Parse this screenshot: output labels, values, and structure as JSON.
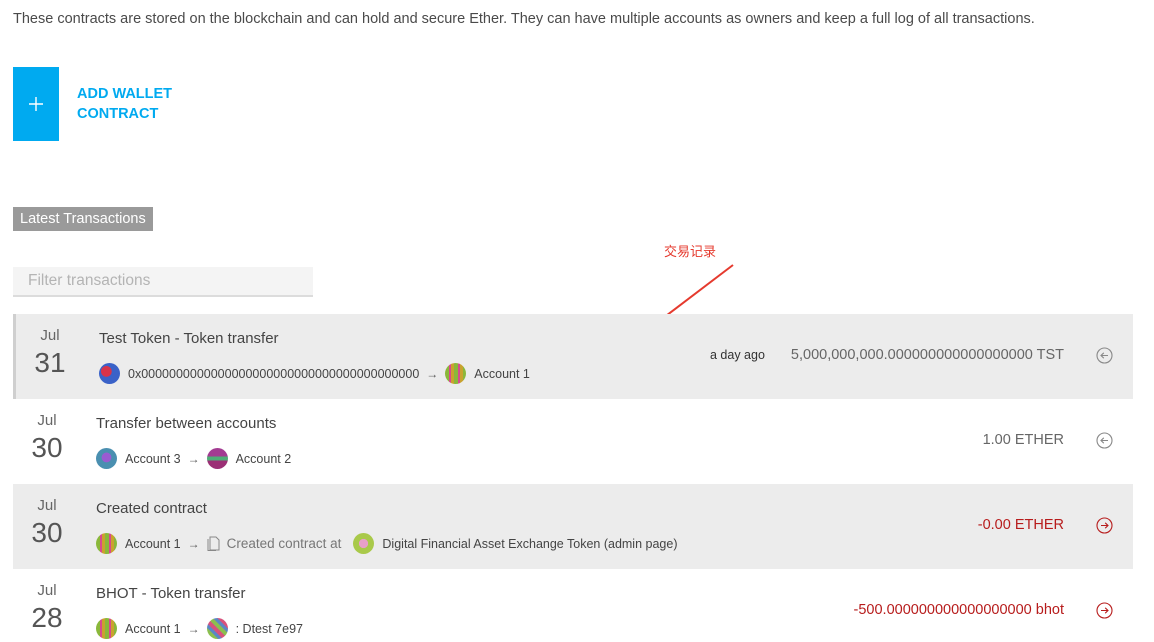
{
  "intro_text": "These contracts are stored on the blockchain and can hold and secure Ether. They can have multiple accounts as owners and keep a full log of all transactions.",
  "add_wallet": {
    "icon": "plus-icon",
    "label": "ADD WALLET CONTRACT"
  },
  "section_title": "Latest Transactions",
  "annotation": {
    "text": "交易记录",
    "color": "#e53a2e"
  },
  "filter": {
    "placeholder": "Filter transactions",
    "value": ""
  },
  "colors": {
    "accent": "#00aaf0",
    "negative": "#b71c1c",
    "row_shade": "#ececec"
  },
  "transactions": [
    {
      "month": "Jul",
      "day": "31",
      "title": "Test Token - Token transfer",
      "from": "0x0000000000000000000000000000000000000000",
      "to": "Account 1",
      "time": "a day ago",
      "amount": "5,000,000,000.000000000000000000 TST",
      "direction": "incoming"
    },
    {
      "month": "Jul",
      "day": "30",
      "title": "Transfer between accounts",
      "from": "Account 3",
      "to": "Account 2",
      "time": "",
      "amount": "1.00 ETHER",
      "direction": "incoming"
    },
    {
      "month": "Jul",
      "day": "30",
      "title": "Created contract",
      "from": "Account 1",
      "created_label": "Created contract at",
      "to": "Digital Financial Asset Exchange Token (admin page)",
      "time": "",
      "amount": "-0.00 ETHER",
      "direction": "outgoing"
    },
    {
      "month": "Jul",
      "day": "28",
      "title": "BHOT - Token transfer",
      "from": "Account 1",
      "to": ": Dtest 7e97",
      "time": "",
      "amount": "-500.000000000000000000 bhot",
      "direction": "outgoing"
    }
  ]
}
